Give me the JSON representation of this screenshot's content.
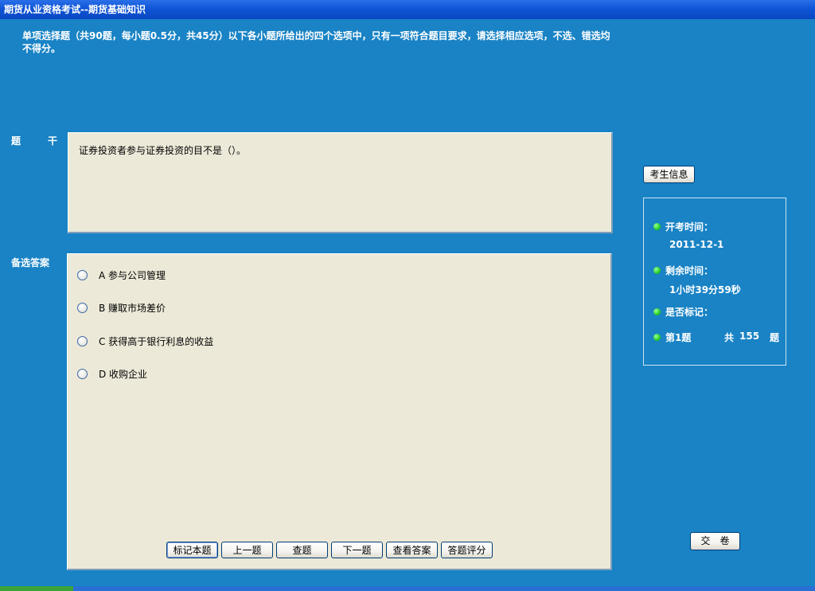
{
  "window": {
    "title": "期货从业资格考试--期货基础知识"
  },
  "instructions": "单项选择题（共90题，每小题0.5分，共45分）以下各小题所给出的四个选项中，只有一项符合题目要求，请选择相应选项，不选、错选均不得分。",
  "labels": {
    "stem": "题干",
    "options": "备选答案"
  },
  "question": {
    "stem": "证券投资者参与证券投资的目不是（）。",
    "options": [
      {
        "label": "A 参与公司管理"
      },
      {
        "label": "B 赚取市场差价"
      },
      {
        "label": "C 获得高于银行利息的收益"
      },
      {
        "label": "D 收购企业"
      }
    ]
  },
  "buttons": {
    "mark": "标记本题",
    "prev": "上一题",
    "check": "查题",
    "next": "下一题",
    "answer": "查看答案",
    "score": "答题评分",
    "student_info": "考生信息",
    "submit": "交　卷"
  },
  "info": {
    "start_label": "开考时间：",
    "start_value": "2011-12-1",
    "remain_label": "剩余时间：",
    "remain_value": "1小时39分59秒",
    "marked_label": "是否标记：",
    "current": "第1题",
    "total_prefix": "共",
    "total": "155",
    "total_suffix": "题"
  },
  "colors": {
    "background": "#1983c5",
    "panel": "#ece9d8",
    "indicator": "#25d025"
  }
}
